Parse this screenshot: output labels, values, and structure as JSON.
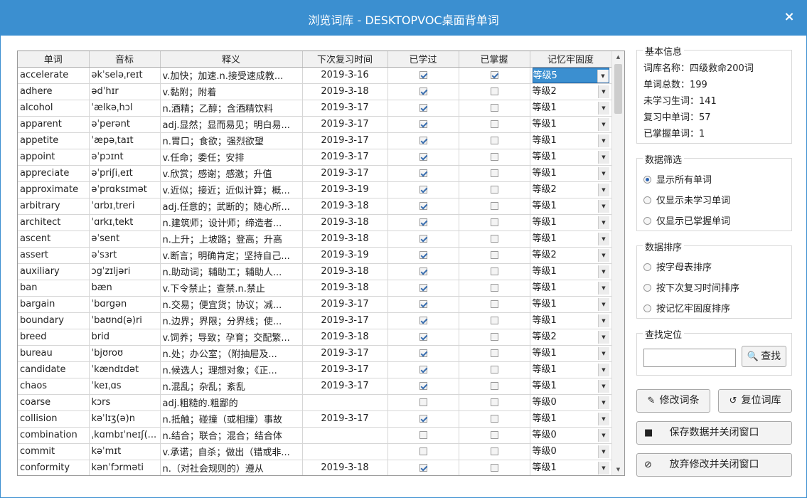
{
  "window": {
    "title": "浏览词库 - DESKTOPVOC桌面背单词",
    "close_glyph": "×"
  },
  "grid": {
    "columns": [
      "单词",
      "音标",
      "释义",
      "下次复习时间",
      "已学过",
      "已掌握",
      "记忆牢固度"
    ],
    "rows": [
      {
        "word": "accelerate",
        "phonetic": "əkˈseləˌreɪt",
        "meaning": "v.加快；加速.n.接受速成教...",
        "date": "2019-3-16",
        "learned": true,
        "mastered": true,
        "level": "等级5",
        "selected": true
      },
      {
        "word": "adhere",
        "phonetic": "ədˈhɪr",
        "meaning": "v.黏附；附着",
        "date": "2019-3-18",
        "learned": true,
        "mastered": false,
        "level": "等级2"
      },
      {
        "word": "alcohol",
        "phonetic": "ˈælkəˌhɔl",
        "meaning": "n.酒精；乙醇；含酒精饮料",
        "date": "2019-3-17",
        "learned": true,
        "mastered": false,
        "level": "等级1"
      },
      {
        "word": "apparent",
        "phonetic": "əˈperənt",
        "meaning": "adj.显然；显而易见；明白易...",
        "date": "2019-3-17",
        "learned": true,
        "mastered": false,
        "level": "等级1"
      },
      {
        "word": "appetite",
        "phonetic": "ˈæpəˌtaɪt",
        "meaning": "n.胃口；食欲；强烈欲望",
        "date": "2019-3-17",
        "learned": true,
        "mastered": false,
        "level": "等级1"
      },
      {
        "word": "appoint",
        "phonetic": "əˈpɔɪnt",
        "meaning": "v.任命；委任；安排",
        "date": "2019-3-17",
        "learned": true,
        "mastered": false,
        "level": "等级1"
      },
      {
        "word": "appreciate",
        "phonetic": "əˈpriʃiˌeɪt",
        "meaning": "v.欣赏；感谢；感激；升值",
        "date": "2019-3-17",
        "learned": true,
        "mastered": false,
        "level": "等级1"
      },
      {
        "word": "approximate",
        "phonetic": "əˈprɑksɪmət",
        "meaning": "v.近似；接近；近似计算；概...",
        "date": "2019-3-19",
        "learned": true,
        "mastered": false,
        "level": "等级2"
      },
      {
        "word": "arbitrary",
        "phonetic": "ˈɑrbɪˌtreri",
        "meaning": "adj.任意的；武断的；随心所...",
        "date": "2019-3-18",
        "learned": true,
        "mastered": false,
        "level": "等级1"
      },
      {
        "word": "architect",
        "phonetic": "ˈɑrkɪˌtekt",
        "meaning": "n.建筑师；设计师；缔造者...",
        "date": "2019-3-18",
        "learned": true,
        "mastered": false,
        "level": "等级1"
      },
      {
        "word": "ascent",
        "phonetic": "əˈsent",
        "meaning": "n.上升；上坡路；登高；升高",
        "date": "2019-3-18",
        "learned": true,
        "mastered": false,
        "level": "等级1"
      },
      {
        "word": "assert",
        "phonetic": "əˈsɜrt",
        "meaning": "v.断言；明确肯定；坚持自己...",
        "date": "2019-3-19",
        "learned": true,
        "mastered": false,
        "level": "等级2"
      },
      {
        "word": "auxiliary",
        "phonetic": "ɔgˈzɪljəri",
        "meaning": "n.助动词；辅助工；辅助人...",
        "date": "2019-3-18",
        "learned": true,
        "mastered": false,
        "level": "等级1"
      },
      {
        "word": "ban",
        "phonetic": "bæn",
        "meaning": "v.下令禁止；查禁.n.禁止",
        "date": "2019-3-18",
        "learned": true,
        "mastered": false,
        "level": "等级1"
      },
      {
        "word": "bargain",
        "phonetic": "ˈbɑrgən",
        "meaning": "n.交易；便宜货；协议；减...",
        "date": "2019-3-17",
        "learned": true,
        "mastered": false,
        "level": "等级1"
      },
      {
        "word": "boundary",
        "phonetic": "ˈbaʊnd(ə)ri",
        "meaning": "n.边界；界限；分界线；使...",
        "date": "2019-3-17",
        "learned": true,
        "mastered": false,
        "level": "等级1"
      },
      {
        "word": "breed",
        "phonetic": "brid",
        "meaning": "v.饲养；导致；孕育；交配繁...",
        "date": "2019-3-18",
        "learned": true,
        "mastered": false,
        "level": "等级2"
      },
      {
        "word": "bureau",
        "phonetic": "ˈbjʊroʊ",
        "meaning": "n.处；办公室；（附抽屉及...",
        "date": "2019-3-17",
        "learned": true,
        "mastered": false,
        "level": "等级1"
      },
      {
        "word": "candidate",
        "phonetic": "ˈkændɪdət",
        "meaning": "n.候选人；理想对象；《正...",
        "date": "2019-3-17",
        "learned": true,
        "mastered": false,
        "level": "等级1"
      },
      {
        "word": "chaos",
        "phonetic": "ˈkeɪˌɑs",
        "meaning": "n.混乱；杂乱；紊乱",
        "date": "2019-3-17",
        "learned": true,
        "mastered": false,
        "level": "等级1"
      },
      {
        "word": "coarse",
        "phonetic": "kɔrs",
        "meaning": "adj.粗糙的.粗鄙的",
        "date": "",
        "learned": false,
        "mastered": false,
        "level": "等级0"
      },
      {
        "word": "collision",
        "phonetic": "kəˈlɪʒ(ə)n",
        "meaning": "n.抵触；碰撞（或相撞）事故",
        "date": "2019-3-17",
        "learned": true,
        "mastered": false,
        "level": "等级1"
      },
      {
        "word": "combination",
        "phonetic": "ˌkɑmbɪˈneɪʃ(...",
        "meaning": "n.结合；联合；混合；结合体",
        "date": "",
        "learned": false,
        "mastered": false,
        "level": "等级0"
      },
      {
        "word": "commit",
        "phonetic": "kəˈmɪt",
        "meaning": "v.承诺；自杀；做出（错或非...",
        "date": "",
        "learned": false,
        "mastered": false,
        "level": "等级0"
      },
      {
        "word": "conformity",
        "phonetic": "kənˈfɔrməti",
        "meaning": "n.（对社会规则的）遵从",
        "date": "2019-3-18",
        "learned": true,
        "mastered": false,
        "level": "等级1"
      }
    ]
  },
  "info": {
    "title": "基本信息",
    "lines": [
      "词库名称：四级救命200词",
      "单词总数：199",
      "未学习生词：141",
      "复习中单词：57",
      "已掌握单词：1"
    ]
  },
  "filter": {
    "title": "数据筛选",
    "options": [
      "显示所有单词",
      "仅显示未学习单词",
      "仅显示已掌握单词"
    ],
    "selected": 0
  },
  "sort": {
    "title": "数据排序",
    "options": [
      "按字母表排序",
      "按下次复习时间排序",
      "按记忆牢固度排序"
    ]
  },
  "search": {
    "title": "查找定位",
    "placeholder": "",
    "button": "查找"
  },
  "buttons": {
    "edit": "修改词条",
    "reset": "复位词库",
    "save": "保存数据并关闭窗口",
    "discard": "放弃修改并关闭窗口"
  },
  "colors": {
    "titlebar": "#3b8fd0",
    "selection": "#3b8fd0"
  }
}
